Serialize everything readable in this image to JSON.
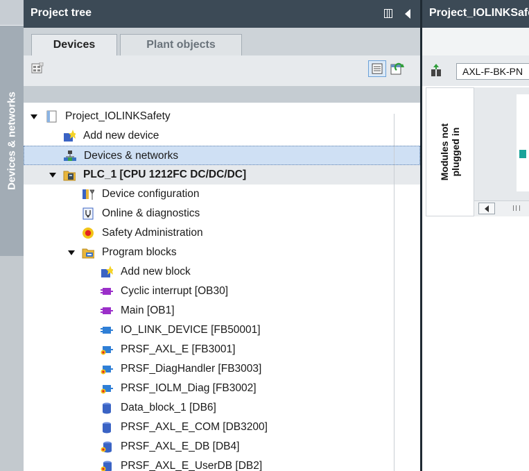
{
  "portal": {
    "vertical_tab_label": "Devices & networks"
  },
  "project_tree": {
    "title": "Project tree",
    "tabs": [
      "Devices",
      "Plant objects"
    ],
    "items": [
      {
        "label": "Project_IOLINKSafety",
        "icon": "project-icon",
        "expanded": true
      },
      {
        "label": "Add new device",
        "icon": "add-device-icon"
      },
      {
        "label": "Devices & networks",
        "icon": "network-icon",
        "selected": true
      },
      {
        "label": "PLC_1 [CPU 1212FC DC/DC/DC]",
        "icon": "plc-folder-icon",
        "expanded": true
      },
      {
        "label": "Device configuration",
        "icon": "device-config-icon"
      },
      {
        "label": "Online & diagnostics",
        "icon": "diagnostics-icon"
      },
      {
        "label": "Safety Administration",
        "icon": "safety-icon"
      },
      {
        "label": "Program blocks",
        "icon": "folder-icon",
        "expanded": true
      },
      {
        "label": "Add new block",
        "icon": "add-block-icon"
      },
      {
        "label": "Cyclic interrupt [OB30]",
        "icon": "ob-block-icon"
      },
      {
        "label": "Main [OB1]",
        "icon": "ob-block-icon"
      },
      {
        "label": "IO_LINK_DEVICE [FB50001]",
        "icon": "fb-block-icon"
      },
      {
        "label": "PRSF_AXL_E [FB3001]",
        "icon": "fb-safety-icon"
      },
      {
        "label": "PRSF_DiagHandler [FB3003]",
        "icon": "fb-safety-icon"
      },
      {
        "label": "PRSF_IOLM_Diag [FB3002]",
        "icon": "fb-safety-icon"
      },
      {
        "label": "Data_block_1 [DB6]",
        "icon": "db-block-icon"
      },
      {
        "label": "PRSF_AXL_E_COM [DB3200]",
        "icon": "db-block-icon"
      },
      {
        "label": "PRSF_AXL_E_DB [DB4]",
        "icon": "db-safety-icon"
      },
      {
        "label": "PRSF_AXL_E_UserDB [DB2]",
        "icon": "db-safety-icon"
      }
    ]
  },
  "editor": {
    "title": "Project_IOLINKSafety",
    "device_dropdown": "AXL-F-BK-PN",
    "modules_tab": "Modules not plugged in"
  }
}
